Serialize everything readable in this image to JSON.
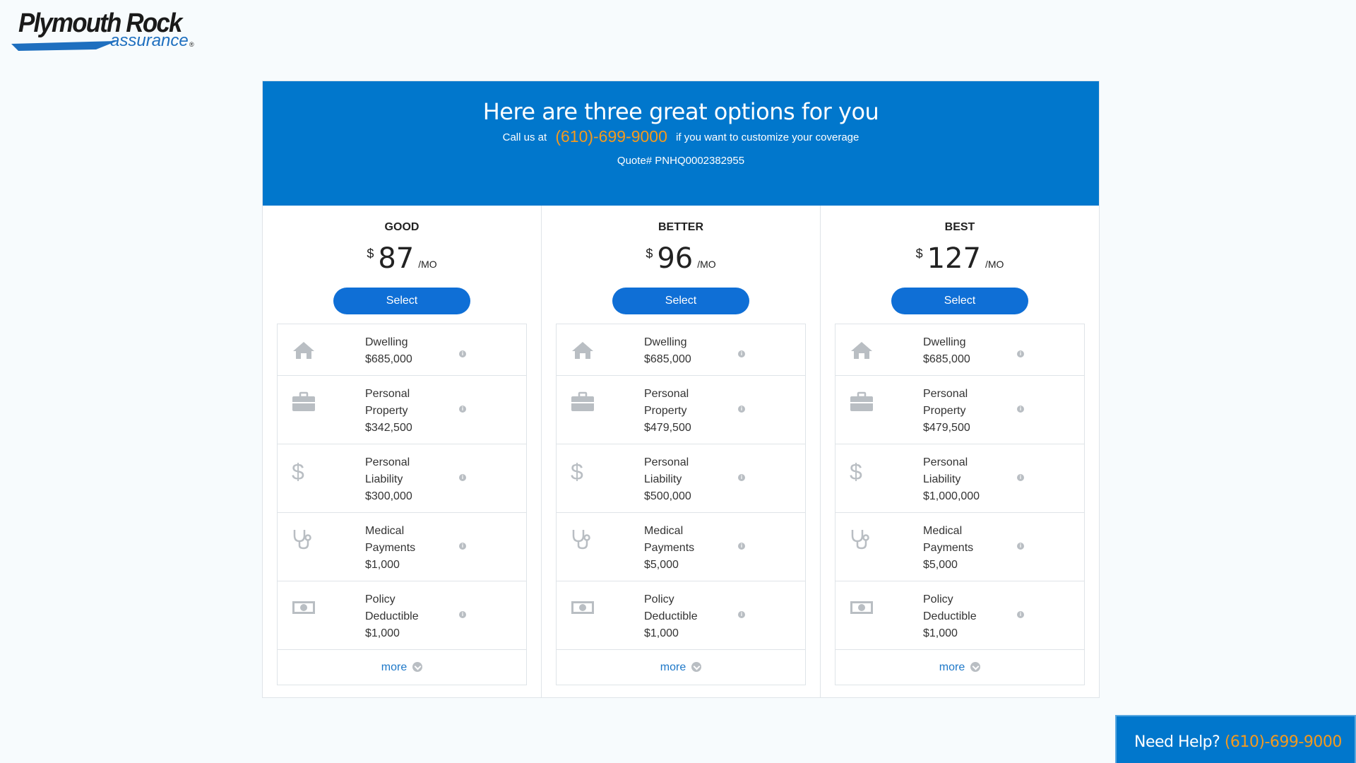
{
  "brand": {
    "name_line1": "Plymouth Rock",
    "name_line2": "assurance",
    "registered": "®",
    "swoosh_color": "#1e6fbf"
  },
  "hero": {
    "title": "Here are three great options for you",
    "call_prefix": "Call us at",
    "phone": "(610)-699-9000",
    "call_suffix": "if you want to customize your coverage",
    "quote": "Quote# PNHQ0002382955"
  },
  "plans": [
    {
      "name": "GOOD",
      "currency": "$",
      "price": "87",
      "period": "/MO",
      "select_label": "Select",
      "coverages": [
        {
          "icon": "house-icon",
          "lines": [
            "Dwelling",
            "$685,000"
          ]
        },
        {
          "icon": "briefcase-icon",
          "lines": [
            "Personal",
            "Property",
            "$342,500"
          ]
        },
        {
          "icon": "dollar-icon",
          "lines": [
            "Personal",
            "Liability",
            "$300,000"
          ]
        },
        {
          "icon": "stethoscope-icon",
          "lines": [
            "Medical",
            "Payments",
            "$1,000"
          ]
        },
        {
          "icon": "cash-icon",
          "lines": [
            "Policy",
            "Deductible",
            "$1,000"
          ]
        }
      ],
      "more_label": "more"
    },
    {
      "name": "BETTER",
      "currency": "$",
      "price": "96",
      "period": "/MO",
      "select_label": "Select",
      "coverages": [
        {
          "icon": "house-icon",
          "lines": [
            "Dwelling",
            "$685,000"
          ]
        },
        {
          "icon": "briefcase-icon",
          "lines": [
            "Personal",
            "Property",
            "$479,500"
          ]
        },
        {
          "icon": "dollar-icon",
          "lines": [
            "Personal",
            "Liability",
            "$500,000"
          ]
        },
        {
          "icon": "stethoscope-icon",
          "lines": [
            "Medical",
            "Payments",
            "$5,000"
          ]
        },
        {
          "icon": "cash-icon",
          "lines": [
            "Policy",
            "Deductible",
            "$1,000"
          ]
        }
      ],
      "more_label": "more"
    },
    {
      "name": "BEST",
      "currency": "$",
      "price": "127",
      "period": "/MO",
      "select_label": "Select",
      "coverages": [
        {
          "icon": "house-icon",
          "lines": [
            "Dwelling",
            "$685,000"
          ]
        },
        {
          "icon": "briefcase-icon",
          "lines": [
            "Personal",
            "Property",
            "$479,500"
          ]
        },
        {
          "icon": "dollar-icon",
          "lines": [
            "Personal",
            "Liability",
            "$1,000,000"
          ]
        },
        {
          "icon": "stethoscope-icon",
          "lines": [
            "Medical",
            "Payments",
            "$5,000"
          ]
        },
        {
          "icon": "cash-icon",
          "lines": [
            "Policy",
            "Deductible",
            "$1,000"
          ]
        }
      ],
      "more_label": "more"
    }
  ],
  "help": {
    "label": "Need Help?",
    "phone": "(610)-699-9000"
  },
  "colors": {
    "primary_blue": "#0177cc",
    "button_blue": "#0f6fd6",
    "accent_orange": "#f49a1e",
    "icon_gray": "#b9bec3"
  }
}
